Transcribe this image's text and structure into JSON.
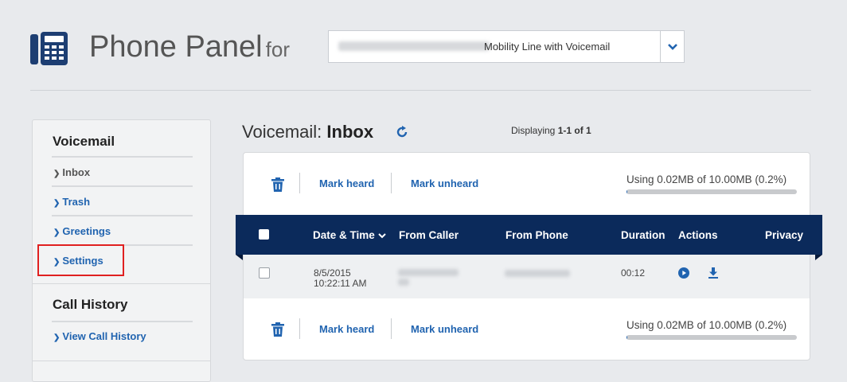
{
  "header": {
    "title": "Phone Panel",
    "for_label": "for",
    "line_select_value": "Mobility Line with Voicemail",
    "icon": "desk-phone-icon"
  },
  "sidebar": {
    "voicemail_heading": "Voicemail",
    "voicemail_items": [
      {
        "label": "Inbox",
        "active": true
      },
      {
        "label": "Trash",
        "active": false
      },
      {
        "label": "Greetings",
        "active": false
      },
      {
        "label": "Settings",
        "active": false
      }
    ],
    "call_history_heading": "Call History",
    "call_history_items": [
      {
        "label": "View Call History"
      }
    ]
  },
  "main": {
    "title_prefix": "Voicemail:",
    "title_folder": "Inbox",
    "displaying_prefix": "Displaying",
    "displaying_range": "1-1 of 1"
  },
  "toolbar": {
    "mark_heard": "Mark heard",
    "mark_unheard": "Mark unheard",
    "usage_text": "Using 0.02MB of 10.00MB (0.2%)",
    "usage_fraction": 0.002
  },
  "table": {
    "columns": [
      "Date & Time",
      "From Caller",
      "From Phone",
      "Duration",
      "Actions",
      "Privacy"
    ],
    "rows": [
      {
        "date": "8/5/2015",
        "time": "10:22:11 AM",
        "duration": "00:12"
      }
    ]
  },
  "colors": {
    "accent": "#2164b0",
    "header_band": "#0b2a5b",
    "highlight_box": "#e02020"
  }
}
